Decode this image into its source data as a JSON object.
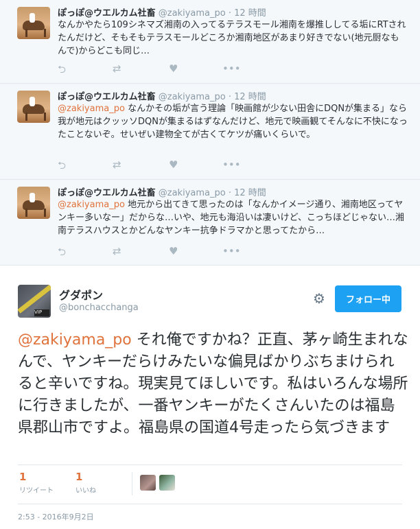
{
  "tweets": [
    {
      "name": "ぽっぽ@ウエルカム社畜",
      "meta": " @zakiyama_po · 12 時間",
      "mention": "",
      "text": "なんかやたら109シネマズ湘南の入ってるテラスモール湘南を爆推ししてる垢にRTされたんだけど、そもそもテラスモールどころか湘南地区があまり好きでない(地元厨なもんで)からどこも同じ…"
    },
    {
      "name": "ぽっぽ@ウエルカム社畜",
      "meta": " @zakiyama_po · 12 時間",
      "mention": "@zakiyama_po",
      "text": " なんかその垢が言う理論「映画館が少ない田舎にDQNが集まる」なら我が地元はクッッソDQNが集まるはずなんだけど、地元で映画観てそんなに不快になったことないぞ。せいぜい建物全てが古くてケツが痛いくらいで。"
    },
    {
      "name": "ぽっぽ@ウエルカム社畜",
      "meta": " @zakiyama_po · 12 時間",
      "mention": "@zakiyama_po",
      "text": " 地元から出てきて思ったのは「なんかイメージ通り、湘南地区ってヤンキー多いなー」だからな…いや、地元も海沿いは凄いけど、こっちほどじゃない…湘南テラスハウスとかどんなヤンキー抗争ドラマかと思ってたから…"
    }
  ],
  "actions": {
    "reply": "⮌",
    "retweet": "⇄",
    "like": "♥",
    "more": "•••"
  },
  "main_tweet": {
    "name": "グダポン",
    "handle": "@bonchacchanga",
    "follow_label": "フォロー中",
    "mention": "@zakiyama_po",
    "text": " それ俺ですかね？正直、茅ヶ崎生まれなんで、ヤンキーだらけみたいな偏見ばかりぶちまけられると辛いですね。現実見てほしいです。私はいろんな場所に行きましたが、一番ヤンキーがたくさんいたのは福島県郡山市ですよ。福島県の国道4号走ったら気づきます",
    "retweets": "1",
    "retweets_label": "リツイート",
    "likes": "1",
    "likes_label": "いいね",
    "timestamp": "2:53 - 2016年9月2日",
    "avatar_tag": "VIP"
  },
  "colors": {
    "accent_orange": "#e0723c",
    "follow_blue": "#1da1f2",
    "muted": "#8899a6"
  }
}
